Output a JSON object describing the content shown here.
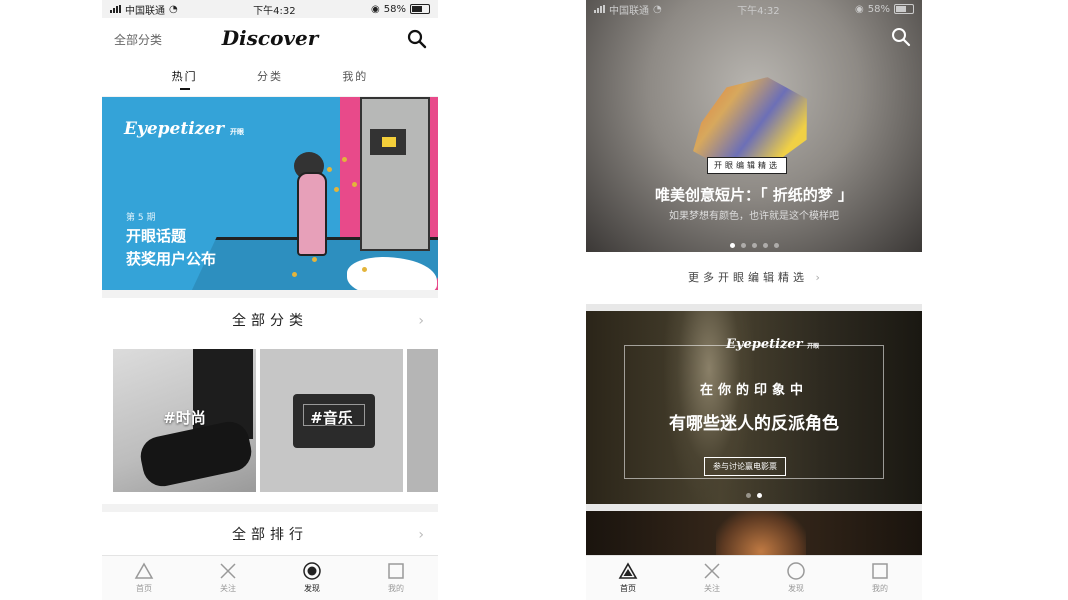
{
  "left": {
    "status": {
      "carrier": "中国联通",
      "time": "下午4:32",
      "battery": "58%"
    },
    "header": {
      "category_link": "全部分类",
      "logo": "Discover"
    },
    "tabs": [
      {
        "label": "热门",
        "active": true
      },
      {
        "label": "分类"
      },
      {
        "label": "我的"
      }
    ],
    "banner": {
      "brand": "Eyepetizer",
      "brand_sub": "开眼",
      "issue": "第 5 期",
      "title_line1": "开眼话题",
      "title_line2": "获奖用户公布"
    },
    "categories": {
      "title": "全部分类",
      "chevron": "›",
      "items": [
        {
          "label": "#时尚"
        },
        {
          "label": "#音乐"
        }
      ]
    },
    "ranking": {
      "title": "全部排行",
      "chevron": "›"
    },
    "nav": [
      {
        "label": "首页",
        "icon": "triangle-icon"
      },
      {
        "label": "关注",
        "icon": "cross-icon"
      },
      {
        "label": "发现",
        "icon": "target-icon",
        "active": true
      },
      {
        "label": "我的",
        "icon": "square-icon"
      }
    ]
  },
  "right": {
    "status": {
      "carrier": "中国联通",
      "time": "下午4:32",
      "battery": "58%"
    },
    "hero": {
      "tag": "开眼编辑精选",
      "title": "唯美创意短片：「 折纸的梦 」",
      "subtitle": "如果梦想有颜色，也许就是这个模样吧",
      "page_count": 5,
      "active_page": 1
    },
    "more": {
      "label": "更多开眼编辑精选",
      "chevron": "›"
    },
    "feature": {
      "brand": "Eyepetizer",
      "brand_sub": "开眼",
      "line1": "在你的印象中",
      "line2": "有哪些迷人的反派角色",
      "button": "参与讨论赢电影票",
      "page_count": 2,
      "active_page": 2
    },
    "nav": [
      {
        "label": "首页",
        "icon": "triangle-icon",
        "active": true
      },
      {
        "label": "关注",
        "icon": "cross-icon"
      },
      {
        "label": "发现",
        "icon": "circle-icon"
      },
      {
        "label": "我的",
        "icon": "square-icon"
      }
    ]
  }
}
